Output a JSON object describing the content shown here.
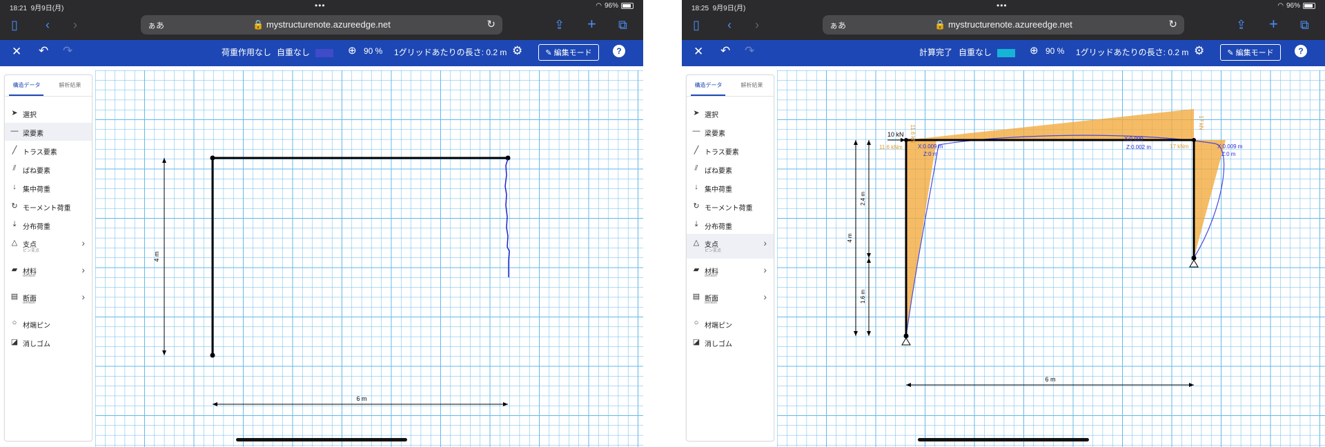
{
  "common": {
    "date": "9月9日(月)",
    "url_prefix": "ぁあ",
    "url": "mystructurenote.azureedge.net",
    "battery": "96%",
    "selfweight": "自重なし",
    "zoom": "90 %",
    "grid_length": "1グリッドあたりの長さ: 0.2 m",
    "edit_mode": "編集モード",
    "tabs": [
      "構造データ",
      "解析結果"
    ],
    "menu": [
      {
        "label": "選択",
        "icon": "pointer-icon"
      },
      {
        "label": "梁要素",
        "icon": "beam-icon"
      },
      {
        "label": "トラス要素",
        "icon": "truss-icon"
      },
      {
        "label": "ばね要素",
        "icon": "spring-icon"
      },
      {
        "label": "集中荷重",
        "icon": "point-load-icon"
      },
      {
        "label": "モーメント荷重",
        "icon": "moment-icon"
      },
      {
        "label": "分布荷重",
        "icon": "distributed-load-icon"
      },
      {
        "label": "支点",
        "sub": "ピン支点",
        "icon": "support-icon"
      },
      {
        "label": "材料",
        "sub": "default",
        "icon": "material-icon"
      },
      {
        "label": "断面",
        "sub": "default",
        "icon": "section-icon"
      },
      {
        "label": "材端ピン",
        "icon": "end-pin-icon"
      },
      {
        "label": "消しゴム",
        "icon": "eraser-icon"
      }
    ],
    "colors": {
      "toolbar": "#1d47b4",
      "grid": "#62b8ea",
      "frame": "#000000",
      "moment": "#f3a93a",
      "deform": "#2b2bd6"
    }
  },
  "left": {
    "time": "18:21",
    "load_status": "荷重作用なし",
    "swatch_color": "#3f4bc9",
    "selected_menu": "梁要素",
    "dims": {
      "horizontal": "6 m",
      "vertical": "4 m"
    }
  },
  "right": {
    "time": "18:25",
    "load_status": "計算完了",
    "swatch_color": "#17b3d6",
    "selected_menu": "支点",
    "dims": {
      "horizontal": "6 m",
      "vertical": "4 m",
      "upper": "2.4 m",
      "lower": "1.6 m"
    },
    "labels": {
      "load": "10 kN",
      "moment_left_vert": "11.6 kN",
      "moment_left": "11.6 kNm",
      "disp_left_x": "X:0.009 m",
      "disp_left_z": "Z:0 m",
      "disp_mid_x": "X:0.009",
      "disp_mid_z": "Z:0.002 m",
      "moment_right": "17 kNm",
      "moment_right_vert": "17 kN",
      "disp_right_x": "X:0.009 m",
      "disp_right_z": "Z:0 m"
    }
  }
}
